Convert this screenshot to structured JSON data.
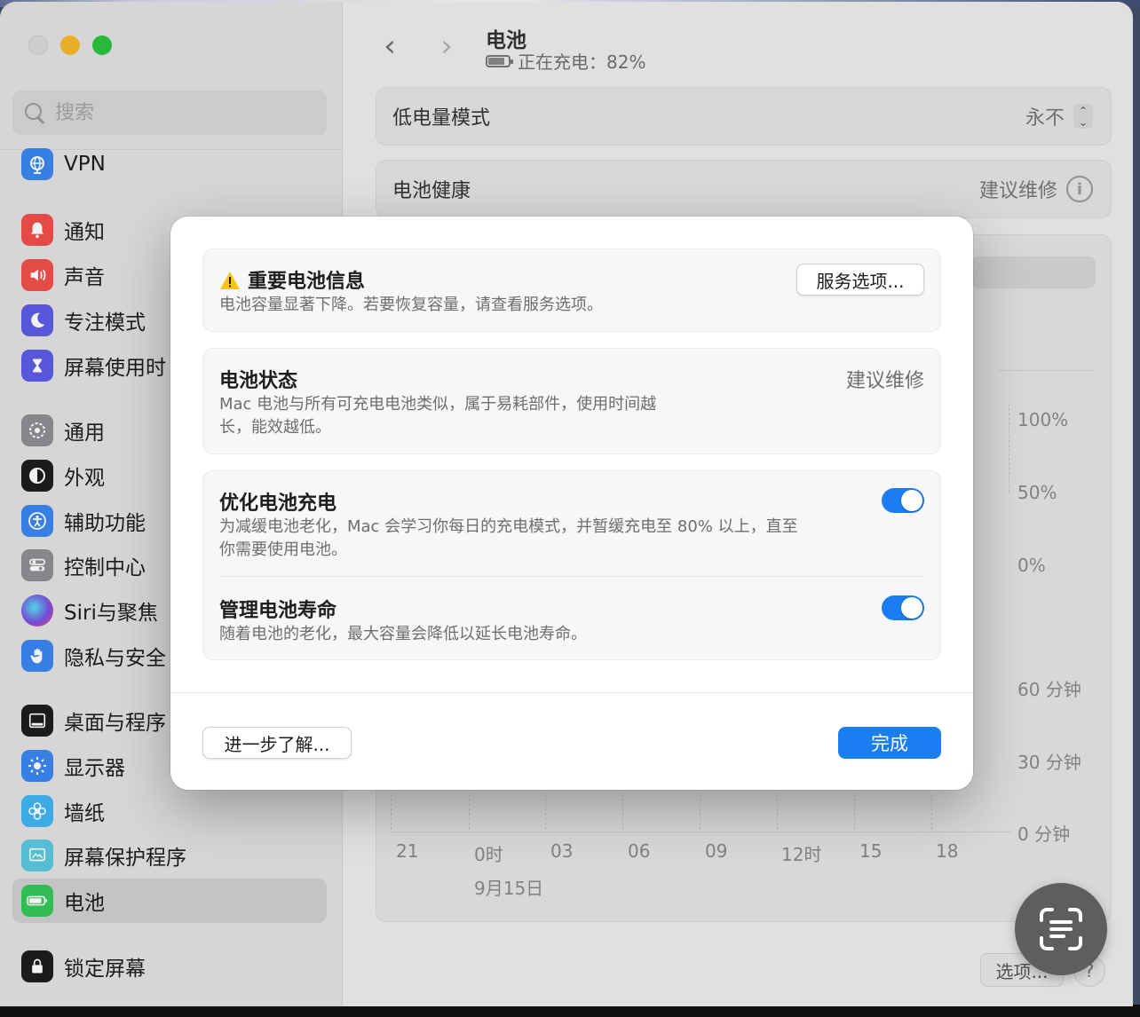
{
  "sidebar": {
    "search_placeholder": "搜索",
    "items": [
      {
        "label": "VPN",
        "icon": "globe-icon",
        "color": "#3a86f0"
      },
      {
        "label": "通知",
        "icon": "bell-icon",
        "color": "#f2504a"
      },
      {
        "label": "声音",
        "icon": "speaker-icon",
        "color": "#f2504a"
      },
      {
        "label": "专注模式",
        "icon": "moon-icon",
        "color": "#5d5ce6"
      },
      {
        "label": "屏幕使用时",
        "icon": "hourglass-icon",
        "color": "#5d5ce6"
      },
      {
        "label": "通用",
        "icon": "gear-icon",
        "color": "#8e8e93"
      },
      {
        "label": "外观",
        "icon": "appearance-icon",
        "color": "#1d1d1f"
      },
      {
        "label": "辅助功能",
        "icon": "accessibility-icon",
        "color": "#3a86f0"
      },
      {
        "label": "控制中心",
        "icon": "control-center-icon",
        "color": "#8e8e93"
      },
      {
        "label": "Siri与聚焦",
        "icon": "siri-icon",
        "color": "#7a4fe0"
      },
      {
        "label": "隐私与安全",
        "icon": "hand-icon",
        "color": "#3a86f0"
      },
      {
        "label": "桌面与程序",
        "icon": "dock-icon",
        "color": "#1d1d1f"
      },
      {
        "label": "显示器",
        "icon": "sun-icon",
        "color": "#3a86f0"
      },
      {
        "label": "墙纸",
        "icon": "flower-icon",
        "color": "#40b5f0"
      },
      {
        "label": "屏幕保护程序",
        "icon": "screensaver-icon",
        "color": "#5ac8e0"
      },
      {
        "label": "电池",
        "icon": "battery-icon",
        "color": "#34c759"
      },
      {
        "label": "锁定屏幕",
        "icon": "lock-icon",
        "color": "#1d1d1f"
      }
    ]
  },
  "header": {
    "title": "电池",
    "subtitle": "正在充电：82%"
  },
  "settings": {
    "low_power_label": "低电量模式",
    "low_power_value": "永不",
    "health_label": "电池健康",
    "health_value": "建议维修"
  },
  "chart_axis": {
    "y_top": [
      "100%",
      "50%",
      "0%"
    ],
    "y_bottom": [
      "60 分钟",
      "30 分钟",
      "0 分钟"
    ],
    "x": [
      "21",
      "0时",
      "03",
      "06",
      "09",
      "12时",
      "15",
      "18"
    ],
    "date": "9月15日"
  },
  "footer": {
    "options_label": "选项...",
    "help_label": "?"
  },
  "dialog": {
    "warning_title": "重要电池信息",
    "warning_desc": "电池容量显著下降。若要恢复容量，请查看服务选项。",
    "service_button": "服务选项...",
    "status_title": "电池状态",
    "status_value": "建议维修",
    "status_desc_line1": "Mac 电池与所有可充电电池类似，属于易耗部件，使用时间越",
    "status_desc_line2": "长，能效越低。",
    "optimize_title": "优化电池充电",
    "optimize_desc_line1": "为减缓电池老化，Mac 会学习你每日的充电模式，并暂缓充电至 80% 以上，直至",
    "optimize_desc_line2": "你需要使用电池。",
    "optimize_on": true,
    "manage_title": "管理电池寿命",
    "manage_desc": "随着电池的老化，最大容量会降低以延长电池寿命。",
    "manage_on": true,
    "learn_more_button": "进一步了解...",
    "done_button": "完成"
  },
  "colors": {
    "accent": "#1a7df2",
    "warning": "#f5c518"
  }
}
